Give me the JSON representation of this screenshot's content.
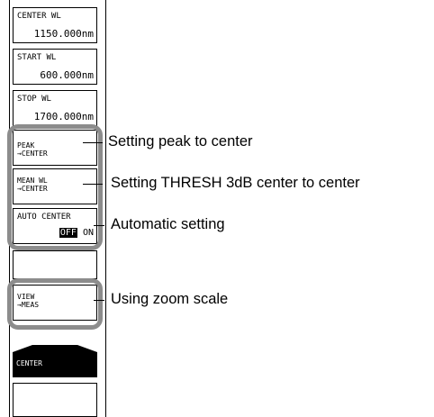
{
  "softkeys": {
    "center_wl": {
      "label": "CENTER WL",
      "value": "1150.000nm"
    },
    "start_wl": {
      "label": "START WL",
      "value": "600.000nm"
    },
    "stop_wl": {
      "label": "STOP WL",
      "value": "1700.000nm"
    },
    "peak_center": {
      "label": "PEAK\n→CENTER"
    },
    "mean_center": {
      "label": "MEAN WL\n→CENTER"
    },
    "auto_center": {
      "label": "AUTO CENTER",
      "off": "OFF",
      "on": "ON"
    },
    "view_meas": {
      "label": "VIEW\n→MEAS"
    },
    "center_tab": {
      "label": "CENTER"
    }
  },
  "callouts": {
    "peak": "Setting peak to center",
    "mean": "Setting THRESH 3dB center to center",
    "auto": "Automatic setting",
    "zoom": "Using zoom scale"
  },
  "colors": {
    "highlight_frame": "#8c8c8c",
    "active_tab": "#000000",
    "text": "#000000"
  }
}
